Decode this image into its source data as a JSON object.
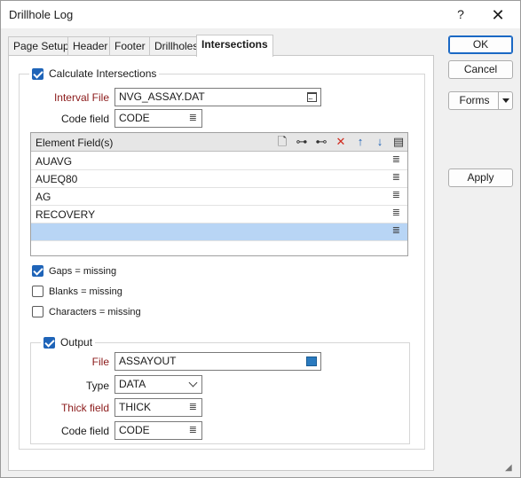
{
  "window": {
    "title": "Drillhole Log",
    "help": "?",
    "close": "✕"
  },
  "tabs": [
    "Page Setup",
    "Header",
    "Footer",
    "Drillholes",
    "Intersections"
  ],
  "intersections": {
    "calc_label": "Calculate Intersections",
    "calc_checked": true,
    "interval_file_label": "Interval File",
    "interval_file_value": "NVG_ASSAY.DAT",
    "code_field_label": "Code field",
    "code_field_value": "CODE",
    "elements": {
      "header": "Element Field(s)",
      "rows": [
        "AUAVG",
        "AUEQ80",
        "AG",
        "RECOVERY",
        ""
      ]
    },
    "gaps_label": "Gaps = missing",
    "gaps_checked": true,
    "blanks_label": "Blanks = missing",
    "blanks_checked": false,
    "characters_label": "Characters = missing",
    "characters_checked": false
  },
  "output": {
    "label": "Output",
    "checked": true,
    "file_label": "File",
    "file_value": "ASSAYOUT",
    "type_label": "Type",
    "type_value": "DATA",
    "thick_label": "Thick field",
    "thick_value": "THICK",
    "code_label": "Code field",
    "code_value": "CODE"
  },
  "buttons": {
    "ok": "OK",
    "cancel": "Cancel",
    "forms": "Forms",
    "apply": "Apply"
  },
  "colors": {
    "accent": "#1f64b8",
    "selection": "#b8d5f5",
    "required_label": "#8b1a1a"
  }
}
